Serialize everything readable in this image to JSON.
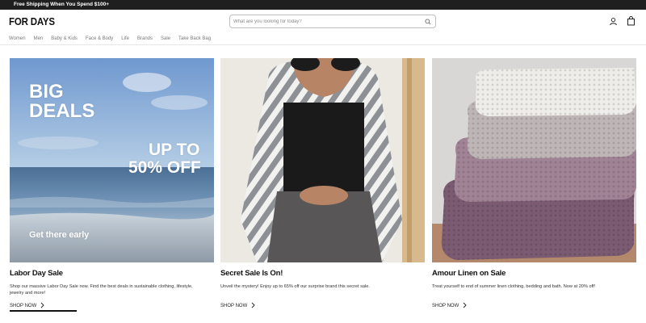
{
  "promo": {
    "text": "Free Shipping When You Spend $100+"
  },
  "header": {
    "logo": "FOR DAYS",
    "search_placeholder": "What are you looking for today?",
    "icons": [
      "search-icon",
      "account-icon",
      "cart-icon"
    ]
  },
  "nav": {
    "items": [
      {
        "label": "Women"
      },
      {
        "label": "Men"
      },
      {
        "label": "Baby & Kids"
      },
      {
        "label": "Face & Body"
      },
      {
        "label": "Life"
      },
      {
        "label": "Brands"
      },
      {
        "label": "Sale"
      },
      {
        "label": "Take Back Bag"
      }
    ]
  },
  "cards": [
    {
      "overlay": {
        "big": "BIG",
        "deals": "DEALS",
        "up_to": "UP TO",
        "percent": "50% OFF",
        "early": "Get there early"
      },
      "title": "Labor Day Sale",
      "description": "Shop our massive Labor Day Sale now. Find the best deals in sustainable clothing, lifestyle, jewelry and more!",
      "cta": "SHOP NOW"
    },
    {
      "title": "Secret Sale Is On!",
      "description": "Unveil the mystery! Enjoy up to 65% off our surprise brand this secret sale.",
      "cta": "SHOP NOW"
    },
    {
      "title": "Amour Linen on Sale",
      "description": "Treat yourself to end of summer linen clothing, bedding and bath. Now at 20% off!",
      "cta": "SHOP NOW"
    }
  ],
  "colors": {
    "promo_bg": "#1f1f1f",
    "text": "#111111",
    "nav_text": "#7a7a7a"
  }
}
